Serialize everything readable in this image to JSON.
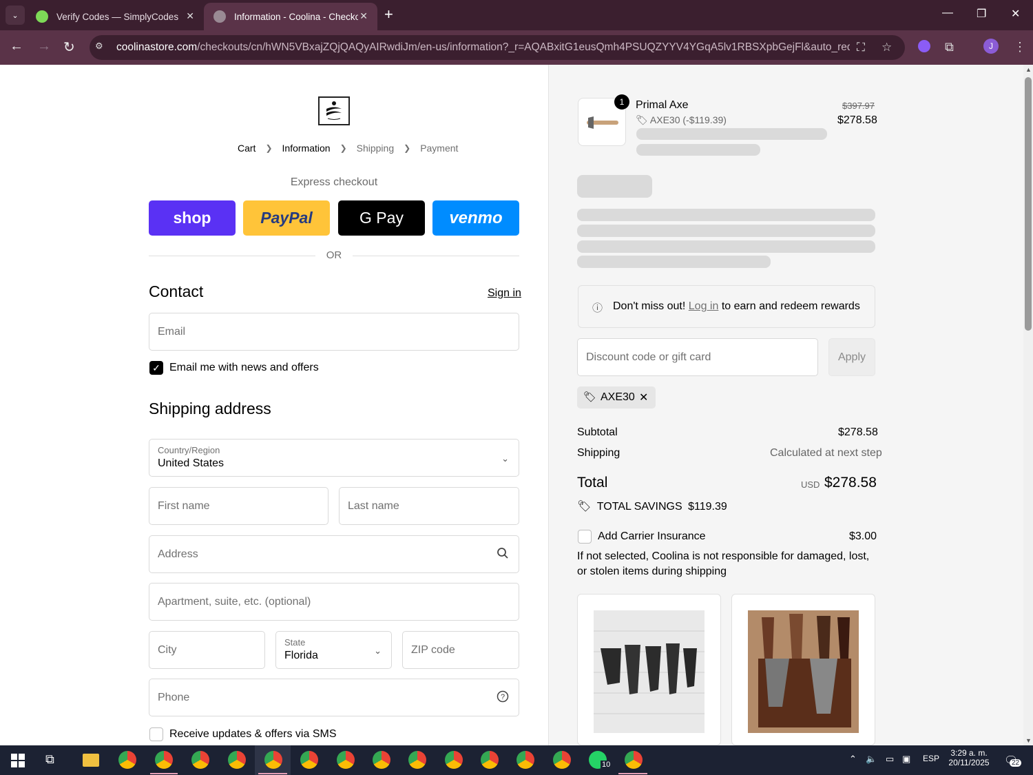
{
  "browser": {
    "tabs": [
      {
        "title": "Verify Codes — SimplyCodes",
        "active": false
      },
      {
        "title": "Information - Coolina - Checko",
        "active": true
      }
    ],
    "url_host": "coolinastore.com",
    "url_path": "/checkouts/cn/hWN5VBxajZQjQAQyAIRwdiJm/en-us/information?_r=AQABxitG1eusQmh4PSUQZYYV4YGqA5lv1RBSXpbGejFl&auto_redirect=f...",
    "profile_initial": "J"
  },
  "checkout": {
    "breadcrumb": [
      "Cart",
      "Information",
      "Shipping",
      "Payment"
    ],
    "express_title": "Express checkout",
    "express_buttons": [
      "shop",
      "PayPal",
      "G Pay",
      "venmo"
    ],
    "or_text": "OR",
    "contact_title": "Contact",
    "sign_in": "Sign in",
    "email_placeholder": "Email",
    "email_news_label": "Email me with news and offers",
    "email_news_checked": true,
    "shipping_title": "Shipping address",
    "country_label": "Country/Region",
    "country_value": "United States",
    "first_name_placeholder": "First name",
    "last_name_placeholder": "Last name",
    "address_placeholder": "Address",
    "apartment_placeholder": "Apartment, suite, etc. (optional)",
    "city_placeholder": "City",
    "state_label": "State",
    "state_value": "Florida",
    "zip_placeholder": "ZIP code",
    "phone_placeholder": "Phone",
    "sms_label": "Receive updates & offers via SMS"
  },
  "summary": {
    "item_qty": "1",
    "item_name": "Primal Axe",
    "item_discount": "AXE30 (-$119.39)",
    "item_original_price": "$397.97",
    "item_price": "$278.58",
    "rewards_prefix": "Don't miss out!",
    "rewards_link": "Log in",
    "rewards_suffix": "to earn and redeem rewards",
    "discount_placeholder": "Discount code or gift card",
    "apply_label": "Apply",
    "applied_code": "AXE30",
    "subtotal_label": "Subtotal",
    "subtotal_value": "$278.58",
    "shipping_label": "Shipping",
    "shipping_value": "Calculated at next step",
    "total_label": "Total",
    "total_currency": "USD",
    "total_value": "$278.58",
    "savings_label": "TOTAL SAVINGS",
    "savings_value": "$119.39",
    "insurance_label": "Add Carrier Insurance",
    "insurance_price": "$3.00",
    "insurance_note": "If not selected, Coolina is not responsible for damaged, lost, or stolen items during shipping"
  },
  "taskbar": {
    "language": "ESP",
    "time": "3:29 a. m.",
    "date": "20/11/2025",
    "notifications": "22",
    "whatsapp_badge": "10"
  }
}
